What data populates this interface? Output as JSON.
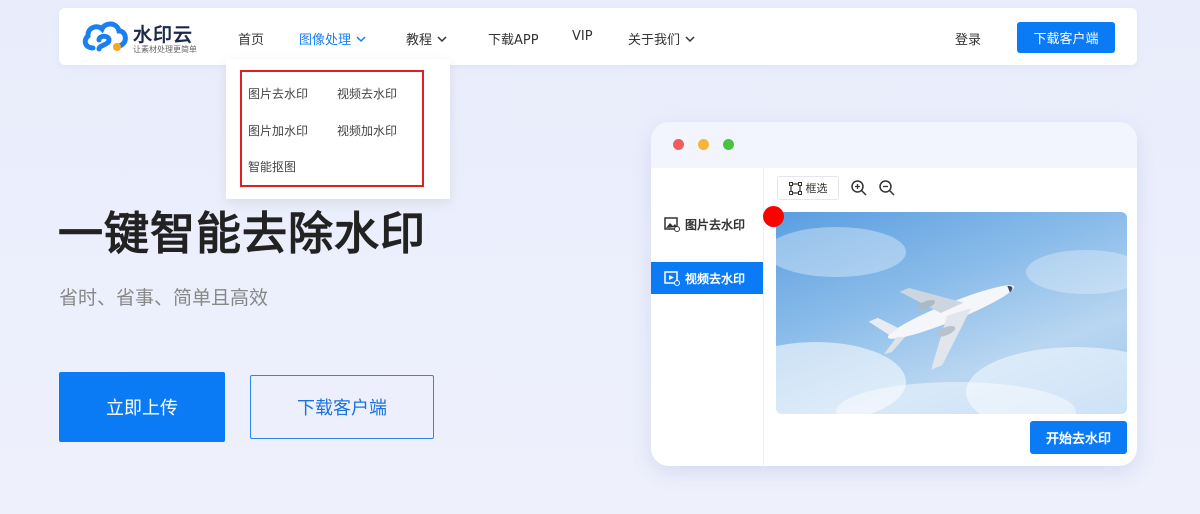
{
  "brand": {
    "name": "水印云",
    "slogan": "让素材处理更简单"
  },
  "nav": {
    "items": [
      {
        "label": "首页"
      },
      {
        "label": "图像处理"
      },
      {
        "label": "教程"
      },
      {
        "label": "下载APP"
      },
      {
        "label": "VIP"
      },
      {
        "label": "关于我们"
      }
    ],
    "login": "登录",
    "download_client": "下载客户端"
  },
  "dropdown": {
    "items": [
      "图片去水印",
      "视频去水印",
      "图片加水印",
      "视频加水印",
      "智能抠图"
    ]
  },
  "hero": {
    "title": "一键智能去除水印",
    "subtitle": "省时、省事、简单且高效",
    "upload_button": "立即上传",
    "client_button": "下载客户端"
  },
  "mock": {
    "traffic_colors": [
      "#f25c5c",
      "#f5b43a",
      "#49c53d"
    ],
    "sidebar": [
      "图片去水印",
      "视频去水印"
    ],
    "tool_select": "框选",
    "start_button": "开始去水印"
  },
  "colors": {
    "accent": "#0a7bf5",
    "highlight": "#e02020",
    "marker": "#ff0000"
  }
}
